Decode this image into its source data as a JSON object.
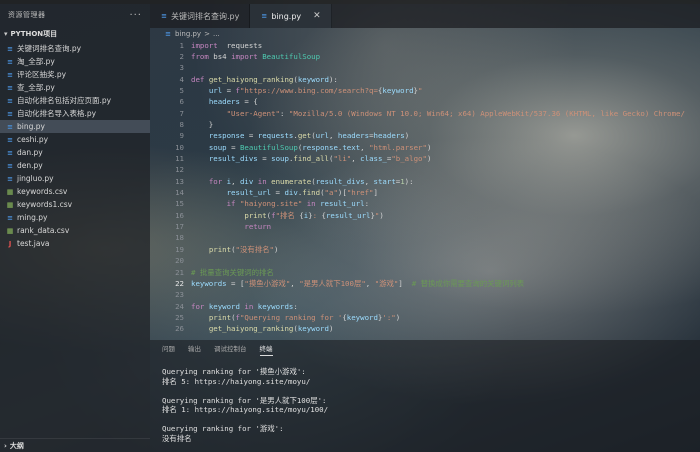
{
  "sidebar": {
    "title": "资源管理器",
    "more": "···",
    "section": "PYTHON项目",
    "outline": "大纲",
    "files": [
      {
        "name": "关键词排名查询.py",
        "type": "py"
      },
      {
        "name": "淘_全部.py",
        "type": "py"
      },
      {
        "name": "评论区抽奖.py",
        "type": "py"
      },
      {
        "name": "查_全部.py",
        "type": "py"
      },
      {
        "name": "自动化排名包括对应页面.py",
        "type": "py"
      },
      {
        "name": "自动化排名导入表格.py",
        "type": "py"
      },
      {
        "name": "bing.py",
        "type": "py",
        "active": true
      },
      {
        "name": "ceshi.py",
        "type": "py"
      },
      {
        "name": "dan.py",
        "type": "py"
      },
      {
        "name": "den.py",
        "type": "py"
      },
      {
        "name": "jingluo.py",
        "type": "py"
      },
      {
        "name": "keywords.csv",
        "type": "csv"
      },
      {
        "name": "keywords1.csv",
        "type": "csv"
      },
      {
        "name": "ming.py",
        "type": "py"
      },
      {
        "name": "rank_data.csv",
        "type": "csv"
      },
      {
        "name": "test.java",
        "type": "java"
      }
    ]
  },
  "tabs": [
    {
      "label": "关键词排名查询.py",
      "active": false
    },
    {
      "label": "bing.py",
      "active": true,
      "close": "✕"
    }
  ],
  "breadcrumb": {
    "file": "bing.py",
    "sep": ">",
    "rest": "..."
  },
  "editor": {
    "current_line": "22",
    "lines": [
      {
        "n": "1",
        "code": [
          [
            "kw",
            "import"
          ],
          [
            "",
            "  requests"
          ]
        ]
      },
      {
        "n": "2",
        "code": [
          [
            "kw",
            "from"
          ],
          [
            "",
            " bs4 "
          ],
          [
            "kw",
            "import"
          ],
          [
            "",
            " "
          ],
          [
            "bi",
            "BeautifulSoup"
          ]
        ]
      },
      {
        "n": "3",
        "code": []
      },
      {
        "n": "4",
        "code": [
          [
            "kw",
            "def"
          ],
          [
            "",
            " "
          ],
          [
            "fn",
            "get_haiyong_ranking"
          ],
          [
            "",
            "("
          ],
          [
            "vr",
            "keyword"
          ],
          [
            "",
            "):"
          ]
        ]
      },
      {
        "n": "5",
        "code": [
          [
            "",
            "    "
          ],
          [
            "vr",
            "url"
          ],
          [
            "",
            " = "
          ],
          [
            "kw",
            "f"
          ],
          [
            "st",
            "\"https://www.bing.com/search?q="
          ],
          [
            "",
            "{"
          ],
          [
            "vr",
            "keyword"
          ],
          [
            "",
            "}"
          ],
          [
            "st",
            "\""
          ]
        ]
      },
      {
        "n": "6",
        "code": [
          [
            "",
            "    "
          ],
          [
            "vr",
            "headers"
          ],
          [
            "",
            " = {"
          ]
        ]
      },
      {
        "n": "7",
        "code": [
          [
            "",
            "        "
          ],
          [
            "st",
            "\"User-Agent\""
          ],
          [
            "",
            ": "
          ],
          [
            "st",
            "\"Mozilla/5.0 (Windows NT 10.0; Win64; x64) AppleWebKit/537.36 (KHTML, like Gecko) Chrome/"
          ]
        ]
      },
      {
        "n": "8",
        "code": [
          [
            "",
            "    }"
          ]
        ]
      },
      {
        "n": "9",
        "code": [
          [
            "",
            "    "
          ],
          [
            "vr",
            "response"
          ],
          [
            "",
            " = "
          ],
          [
            "vr",
            "requests"
          ],
          [
            "",
            "."
          ],
          [
            "fn",
            "get"
          ],
          [
            "",
            "("
          ],
          [
            "vr",
            "url"
          ],
          [
            "",
            ", "
          ],
          [
            "vr",
            "headers"
          ],
          [
            "",
            "="
          ],
          [
            "vr",
            "headers"
          ],
          [
            "",
            ")"
          ]
        ]
      },
      {
        "n": "10",
        "code": [
          [
            "",
            "    "
          ],
          [
            "vr",
            "soup"
          ],
          [
            "",
            " = "
          ],
          [
            "bi",
            "BeautifulSoup"
          ],
          [
            "",
            "("
          ],
          [
            "vr",
            "response"
          ],
          [
            "",
            "."
          ],
          [
            "vr",
            "text"
          ],
          [
            "",
            ", "
          ],
          [
            "st",
            "\"html.parser\""
          ],
          [
            "",
            ")"
          ]
        ]
      },
      {
        "n": "11",
        "code": [
          [
            "",
            "    "
          ],
          [
            "vr",
            "result_divs"
          ],
          [
            "",
            " = "
          ],
          [
            "vr",
            "soup"
          ],
          [
            "",
            "."
          ],
          [
            "fn",
            "find_all"
          ],
          [
            "",
            "("
          ],
          [
            "st",
            "\"li\""
          ],
          [
            "",
            ", "
          ],
          [
            "vr",
            "class_"
          ],
          [
            "",
            "="
          ],
          [
            "st",
            "\"b_algo\""
          ],
          [
            "",
            ")"
          ]
        ]
      },
      {
        "n": "12",
        "code": []
      },
      {
        "n": "13",
        "code": [
          [
            "",
            "    "
          ],
          [
            "kw",
            "for"
          ],
          [
            "",
            " "
          ],
          [
            "vr",
            "i"
          ],
          [
            "",
            ", "
          ],
          [
            "vr",
            "div"
          ],
          [
            "",
            " "
          ],
          [
            "kw",
            "in"
          ],
          [
            "",
            " "
          ],
          [
            "fn",
            "enumerate"
          ],
          [
            "",
            "("
          ],
          [
            "vr",
            "result_divs"
          ],
          [
            "",
            ", "
          ],
          [
            "vr",
            "start"
          ],
          [
            "",
            "="
          ],
          [
            "nu",
            "1"
          ],
          [
            "",
            "):"
          ]
        ]
      },
      {
        "n": "14",
        "code": [
          [
            "",
            "        "
          ],
          [
            "vr",
            "result_url"
          ],
          [
            "",
            " = "
          ],
          [
            "vr",
            "div"
          ],
          [
            "",
            "."
          ],
          [
            "fn",
            "find"
          ],
          [
            "",
            "("
          ],
          [
            "st",
            "\"a\""
          ],
          [
            "",
            ")["
          ],
          [
            "st",
            "\"href\""
          ],
          [
            "",
            "]"
          ]
        ]
      },
      {
        "n": "15",
        "code": [
          [
            "",
            "        "
          ],
          [
            "kw",
            "if"
          ],
          [
            "",
            " "
          ],
          [
            "st",
            "\"haiyong.site\""
          ],
          [
            "",
            " "
          ],
          [
            "kw",
            "in"
          ],
          [
            "",
            " "
          ],
          [
            "vr",
            "result_url"
          ],
          [
            "",
            ":"
          ]
        ]
      },
      {
        "n": "16",
        "code": [
          [
            "",
            "            "
          ],
          [
            "fn",
            "print"
          ],
          [
            "",
            "("
          ],
          [
            "kw",
            "f"
          ],
          [
            "st",
            "\"排名 "
          ],
          [
            "",
            "{"
          ],
          [
            "vr",
            "i"
          ],
          [
            "",
            "}"
          ],
          [
            "st",
            ": "
          ],
          [
            "",
            "{"
          ],
          [
            "vr",
            "result_url"
          ],
          [
            "",
            "}"
          ],
          [
            "st",
            "\""
          ],
          [
            "",
            ")"
          ]
        ]
      },
      {
        "n": "17",
        "code": [
          [
            "",
            "            "
          ],
          [
            "kw",
            "return"
          ]
        ]
      },
      {
        "n": "18",
        "code": []
      },
      {
        "n": "19",
        "code": [
          [
            "",
            "    "
          ],
          [
            "fn",
            "print"
          ],
          [
            "",
            "("
          ],
          [
            "st",
            "\"没有排名\""
          ],
          [
            "",
            ")"
          ]
        ]
      },
      {
        "n": "20",
        "code": []
      },
      {
        "n": "21",
        "code": [
          [
            "cm",
            "# 批量查询关键词的排名"
          ]
        ]
      },
      {
        "n": "22",
        "code": [
          [
            "vr",
            "keywords"
          ],
          [
            "",
            " = ["
          ],
          [
            "st",
            "\"摸鱼小游戏\""
          ],
          [
            "",
            ", "
          ],
          [
            "st",
            "\"是男人就下100层\""
          ],
          [
            "",
            ", "
          ],
          [
            "st",
            "\"游戏\""
          ],
          [
            "",
            "]  "
          ],
          [
            "cm",
            "# 替换成你需要查询的关键词列表"
          ]
        ]
      },
      {
        "n": "23",
        "code": []
      },
      {
        "n": "24",
        "code": [
          [
            "kw",
            "for"
          ],
          [
            "",
            " "
          ],
          [
            "vr",
            "keyword"
          ],
          [
            "",
            " "
          ],
          [
            "kw",
            "in"
          ],
          [
            "",
            " "
          ],
          [
            "vr",
            "keywords"
          ],
          [
            "",
            ":"
          ]
        ]
      },
      {
        "n": "25",
        "code": [
          [
            "",
            "    "
          ],
          [
            "fn",
            "print"
          ],
          [
            "",
            "("
          ],
          [
            "kw",
            "f"
          ],
          [
            "st",
            "\"Querying ranking for '"
          ],
          [
            "",
            "{"
          ],
          [
            "vr",
            "keyword"
          ],
          [
            "",
            "}"
          ],
          [
            "st",
            "':\""
          ],
          [
            "",
            ")"
          ]
        ]
      },
      {
        "n": "26",
        "code": [
          [
            "",
            "    "
          ],
          [
            "fn",
            "get_haiyong_ranking"
          ],
          [
            "",
            "("
          ],
          [
            "vr",
            "keyword"
          ],
          [
            "",
            ")"
          ]
        ]
      }
    ]
  },
  "panel": {
    "tabs": [
      {
        "label": "问题",
        "active": false
      },
      {
        "label": "输出",
        "active": false
      },
      {
        "label": "调试控制台",
        "active": false
      },
      {
        "label": "终端",
        "active": true
      }
    ],
    "terminal": [
      "Querying ranking for '摸鱼小游戏':",
      "排名 5: https://haiyong.site/moyu/",
      "",
      "Querying ranking for '是男人就下100层':",
      "排名 1: https://haiyong.site/moyu/100/",
      "",
      "Querying ranking for '游戏':",
      "没有排名"
    ]
  }
}
